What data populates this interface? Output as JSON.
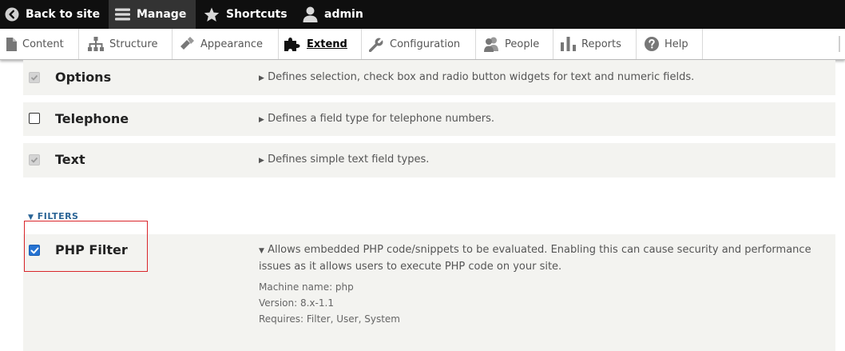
{
  "toolbar": {
    "back_label": "Back to site",
    "manage_label": "Manage",
    "shortcuts_label": "Shortcuts",
    "user_label": "admin"
  },
  "tray": {
    "items": [
      {
        "label": "Content",
        "icon": "file-icon"
      },
      {
        "label": "Structure",
        "icon": "sitemap-icon"
      },
      {
        "label": "Appearance",
        "icon": "paintbrush-icon"
      },
      {
        "label": "Extend",
        "icon": "puzzle-icon",
        "active": true
      },
      {
        "label": "Configuration",
        "icon": "wrench-icon"
      },
      {
        "label": "People",
        "icon": "people-icon"
      },
      {
        "label": "Reports",
        "icon": "bar-chart-icon"
      },
      {
        "label": "Help",
        "icon": "help-icon"
      }
    ]
  },
  "modules": [
    {
      "name": "Options",
      "checkbox": "checked-disabled",
      "description": "Defines selection, check box and radio button widgets for text and numeric fields."
    },
    {
      "name": "Telephone",
      "checkbox": "unchecked",
      "description": "Defines a field type for telephone numbers."
    },
    {
      "name": "Text",
      "checkbox": "checked-disabled",
      "description": "Defines simple text field types."
    }
  ],
  "filters_section": {
    "title": "FILTERS",
    "module": {
      "name": "PHP Filter",
      "checkbox": "checked",
      "description": "Allows embedded PHP code/snippets to be evaluated. Enabling this can cause security and performance issues as it allows users to execute PHP code on your site.",
      "machine_name": "Machine name: php",
      "version": "Version: 8.x-1.1",
      "requires": "Requires: Filter, User, System"
    }
  },
  "colors": {
    "toolbar_bg": "#0f0f0f",
    "manage_bg": "#333333",
    "row_bg": "#f3f3f0",
    "checkbox_checked": "#2673d2",
    "section_link": "#2a6496",
    "highlight": "#d9262b"
  }
}
